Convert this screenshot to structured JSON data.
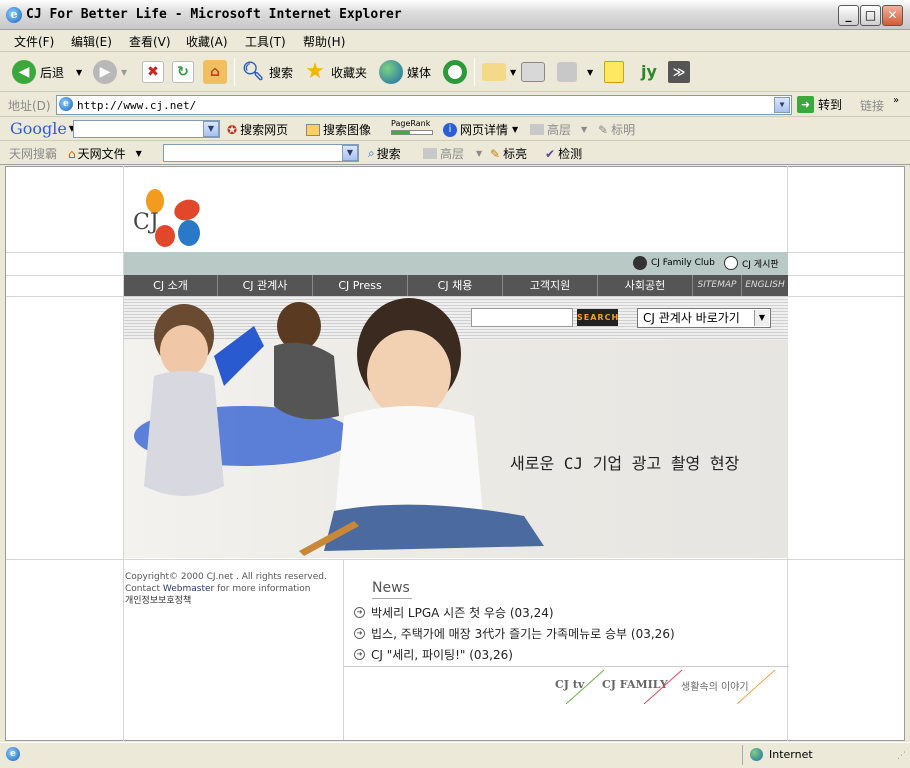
{
  "window": {
    "title": "CJ For Better Life - Microsoft Internet Explorer",
    "controls": [
      "minimize",
      "maximize",
      "close"
    ]
  },
  "menubar": {
    "items": [
      "文件(F)",
      "编辑(E)",
      "查看(V)",
      "收藏(A)",
      "工具(T)",
      "帮助(H)"
    ]
  },
  "toolbar": {
    "back": "后退",
    "search": "搜索",
    "favorites": "收藏夹",
    "media": "媒体"
  },
  "address": {
    "label": "地址(D)",
    "url": "http://www.cj.net/",
    "go": "转到",
    "links": "链接"
  },
  "google_bar": {
    "logo": "Google",
    "search_web": "搜索网页",
    "search_images": "搜索图像",
    "pagerank": "PageRank",
    "page_info": "网页详情",
    "highlight": "高层",
    "mark": "标明"
  },
  "tianwang_bar": {
    "label": "天网搜霸",
    "files": "天网文件",
    "search": "搜索",
    "highlight": "高层",
    "mark": "标亮",
    "check": "检测"
  },
  "site": {
    "logo_text": "CJ",
    "family_club": "CJ Family Club",
    "board": "CJ 게시판",
    "nav": [
      "CJ 소개",
      "CJ 관계사",
      "CJ Press",
      "CJ 채용",
      "고객지원",
      "사회공헌",
      "SITEMAP",
      "ENGLISH"
    ],
    "search_button": "SEARCH",
    "affiliate_select": "CJ 관계사 바로가기",
    "headline": "새로운 CJ 기업 광고 촬영 현장",
    "copyright": "Copyright© 2000 CJ.net . All rights reserved.",
    "contact_prefix": "Contact",
    "contact_link": "Webmaster",
    "contact_suffix": "for more information",
    "privacy": "개인정보보호정책",
    "news_title": "News",
    "news": [
      "박세리 LPGA 시즌 첫 우승 (03,24)",
      "빕스, 주택가에 매장 3代가 즐기는 가족메뉴로 승부 (03,26)",
      "CJ \"세리, 파이팅!\" (03,26)"
    ],
    "bottom_links": [
      "CJ tv",
      "CJ FAMILY",
      "생활속의 이야기"
    ]
  },
  "statusbar": {
    "zone": "Internet"
  },
  "colors": {
    "cj_orange": "#f29b1e",
    "cj_red": "#e2472c",
    "cj_blue": "#2a78c8",
    "nav_bg": "#555555",
    "strip_bg": "#b9c9c6"
  }
}
